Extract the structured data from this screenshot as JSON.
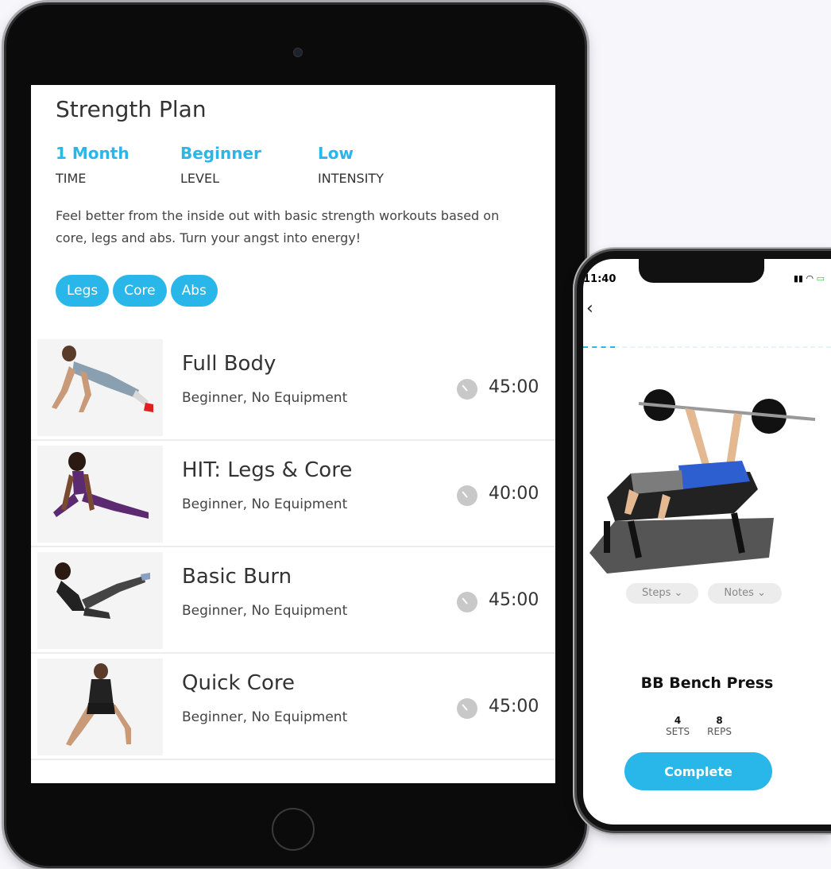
{
  "plan": {
    "title": "Strength Plan",
    "stats": [
      {
        "value": "1 Month",
        "label": "TIME"
      },
      {
        "value": "Beginner",
        "label": "LEVEL"
      },
      {
        "value": "Low",
        "label": "INTENSITY"
      }
    ],
    "description": "Feel better from the inside out with basic strength workouts based on core, legs and abs. Turn your angst into energy!",
    "tags": [
      "Legs",
      "Core",
      "Abs"
    ]
  },
  "workouts": [
    {
      "name": "Full Body",
      "meta": "Beginner, No Equipment",
      "duration": "45:00"
    },
    {
      "name": "HIT: Legs & Core",
      "meta": "Beginner, No Equipment",
      "duration": "40:00"
    },
    {
      "name": "Basic Burn",
      "meta": "Beginner, No Equipment",
      "duration": "45:00"
    },
    {
      "name": "Quick Core",
      "meta": "Beginner, No Equipment",
      "duration": "45:00"
    }
  ],
  "phone": {
    "status_time": "11:40",
    "back": "‹",
    "pills": [
      "Steps ⌄",
      "Notes ⌄"
    ],
    "exercise_name": "BB Bench Press",
    "sets_value": "4",
    "sets_label": "SETS",
    "reps_value": "8",
    "reps_label": "REPS",
    "complete_label": "Complete"
  },
  "colors": {
    "accent": "#29b6e8",
    "text_dark": "#333333"
  },
  "icons": {
    "clock": "clock-icon",
    "back": "chevron-left-icon",
    "signal": "signal-icon",
    "wifi": "wifi-icon",
    "battery": "battery-icon"
  }
}
